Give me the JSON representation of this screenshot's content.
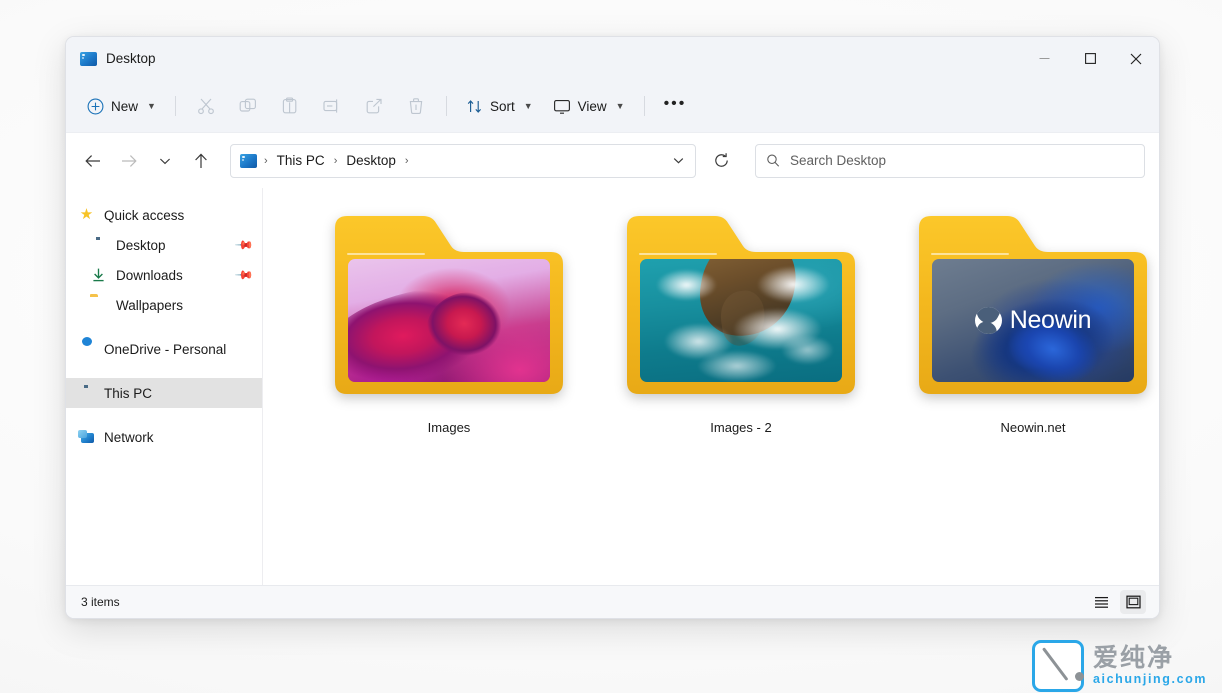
{
  "window": {
    "title": "Desktop",
    "title_icon": "desktop-monitor-icon",
    "controls": {
      "minimize": "minimize-icon",
      "maximize": "maximize-icon",
      "close": "close-icon"
    }
  },
  "toolbar": {
    "new_label": "New",
    "new_icon": "plus-circle-icon",
    "sort_label": "Sort",
    "sort_icon": "sort-arrows-icon",
    "view_label": "View",
    "view_icon": "monitor-icon",
    "more_label": "•••",
    "actions": [
      {
        "name": "cut",
        "icon": "scissors-icon",
        "enabled": false
      },
      {
        "name": "copy",
        "icon": "copy-icon",
        "enabled": false
      },
      {
        "name": "paste",
        "icon": "paste-icon",
        "enabled": false
      },
      {
        "name": "rename",
        "icon": "rename-icon",
        "enabled": false
      },
      {
        "name": "share",
        "icon": "share-icon",
        "enabled": false
      },
      {
        "name": "delete",
        "icon": "trash-icon",
        "enabled": false
      }
    ]
  },
  "navigation": {
    "back_icon": "arrow-left-icon",
    "forward_icon": "arrow-right-icon",
    "recent_icon": "chevron-down-icon",
    "up_icon": "arrow-up-icon",
    "refresh_icon": "refresh-icon",
    "address_dropdown_icon": "chevron-down-icon",
    "breadcrumb": {
      "icon": "desktop-monitor-icon",
      "items": [
        "This PC",
        "Desktop"
      ],
      "separator": "›"
    }
  },
  "search": {
    "placeholder": "Search Desktop",
    "value": "",
    "icon": "search-icon"
  },
  "sidebar": {
    "items": [
      {
        "label": "Quick access",
        "icon": "star-icon",
        "pinned": false,
        "selected": false,
        "level": "root"
      },
      {
        "label": "Desktop",
        "icon": "desktop-monitor-icon",
        "pinned": true,
        "selected": false,
        "level": "child"
      },
      {
        "label": "Downloads",
        "icon": "download-icon",
        "pinned": true,
        "selected": false,
        "level": "child"
      },
      {
        "label": "Wallpapers",
        "icon": "folder-icon",
        "pinned": false,
        "selected": false,
        "level": "child"
      },
      {
        "label": "OneDrive - Personal",
        "icon": "cloud-icon",
        "pinned": false,
        "selected": false,
        "level": "root"
      },
      {
        "label": "This PC",
        "icon": "this-pc-icon",
        "pinned": false,
        "selected": true,
        "level": "root"
      },
      {
        "label": "Network",
        "icon": "network-icon",
        "pinned": false,
        "selected": false,
        "level": "root"
      }
    ]
  },
  "content": {
    "items": [
      {
        "label": "Images",
        "type": "folder",
        "thumbnail": "pink-abstract-bloom"
      },
      {
        "label": "Images - 2",
        "type": "folder",
        "thumbnail": "aerial-ocean-coastline"
      },
      {
        "label": "Neowin.net",
        "type": "folder",
        "thumbnail": "neowin-logo-dark-blue"
      }
    ]
  },
  "neowin_thumb": {
    "wordmark": "Neowin"
  },
  "statusbar": {
    "item_count": "3 items",
    "details_view_icon": "list-lines-icon",
    "large_icons_view_icon": "large-icon-square-icon"
  },
  "watermark": {
    "chinese": "爱纯净",
    "domain": "aichunjing.com"
  },
  "colors": {
    "accent": "#2aa7e8",
    "folder_yellow": "#f4b81e",
    "chrome": "#f2f4f8",
    "selected_row": "#e2e2e2"
  }
}
